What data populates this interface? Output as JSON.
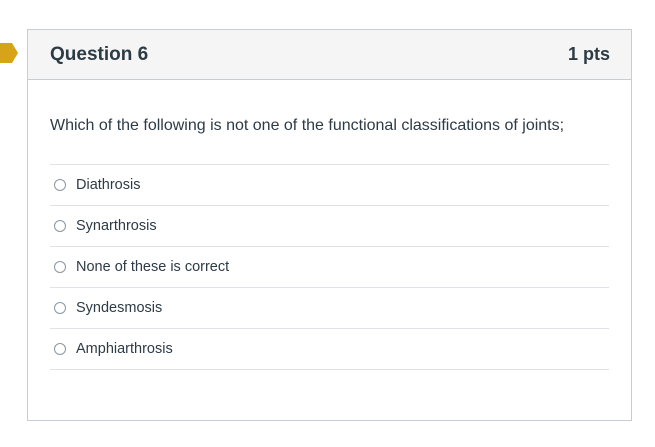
{
  "question": {
    "title": "Question 6",
    "points": "1 pts",
    "text": "Which of the following is not one of the functional classifications of joints;",
    "answers": [
      {
        "label": "Diathrosis"
      },
      {
        "label": "Synarthrosis"
      },
      {
        "label": "None of these is correct"
      },
      {
        "label": "Syndesmosis"
      },
      {
        "label": "Amphiarthrosis"
      }
    ]
  },
  "colors": {
    "flag": "#d7a419",
    "header_bg": "#f5f5f5",
    "border": "#c7cdd1",
    "text": "#2d3b45"
  },
  "icons": {
    "flag": "question-flag-icon",
    "radio": "radio-unchecked-icon"
  }
}
